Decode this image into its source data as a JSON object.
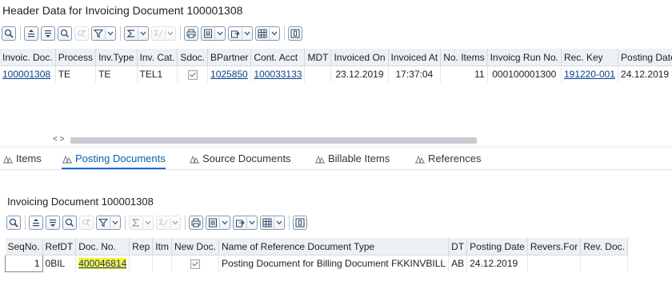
{
  "header": {
    "title": "Header Data for Invoicing Document 100001308",
    "columns": [
      "Invoic. Doc.",
      "Process",
      "Inv.Type",
      "Inv. Cat.",
      "Sdoc.",
      "BPartner",
      "Cont. Acct",
      "MDT",
      "Invoiced On",
      "Invoiced At",
      "No. Items",
      "Invoicg Run No.",
      "Rec. Key",
      "Posting Date"
    ],
    "row": {
      "invoic_doc": "100001308",
      "process": "TE",
      "inv_type": "TE",
      "inv_cat": "TEL1",
      "sdoc_checked": true,
      "bpartner": "1025850",
      "cont_acct": "100033133",
      "mdt": "",
      "invoiced_on": "23.12.2019",
      "invoiced_at": "17:37:04",
      "no_items": "11",
      "run_no": "000100001300",
      "rec_key": "191220-001",
      "posting_date": "24.12.2019"
    },
    "scroll_arrows": "< >"
  },
  "tabs": [
    {
      "label": "Items",
      "icon": "tree-icon",
      "active": false
    },
    {
      "label": "Posting Documents",
      "icon": "tree-icon",
      "active": true
    },
    {
      "label": "Source Documents",
      "icon": "tree-icon",
      "active": false
    },
    {
      "label": "Billable Items",
      "icon": "tree-icon",
      "active": false
    },
    {
      "label": "References",
      "icon": "tree-icon",
      "active": false
    }
  ],
  "posting": {
    "title": "Invoicing Document 100001308",
    "columns": [
      "SeqNo.",
      "RefDT",
      "Doc. No.",
      "Rep",
      "Itm",
      "New Doc.",
      "Name of Reference Document Type",
      "DT",
      "Posting Date",
      "Revers.For",
      "Rev. Doc."
    ],
    "row": {
      "seq": "1",
      "refdt": "0BIL",
      "doc_no": "400046814",
      "rep": "",
      "itm": "",
      "new_doc_checked": true,
      "name": "Posting Document for Billing Document FKKINVBILL",
      "dt": "AB",
      "posting_date": "24.12.2019",
      "revers_for": "",
      "rev_doc": ""
    }
  },
  "colors": {
    "link": "#0b3f8a",
    "highlight": "#fff23a",
    "header_bg": "#eef1f4",
    "active_tab": "#0a6ed1"
  }
}
